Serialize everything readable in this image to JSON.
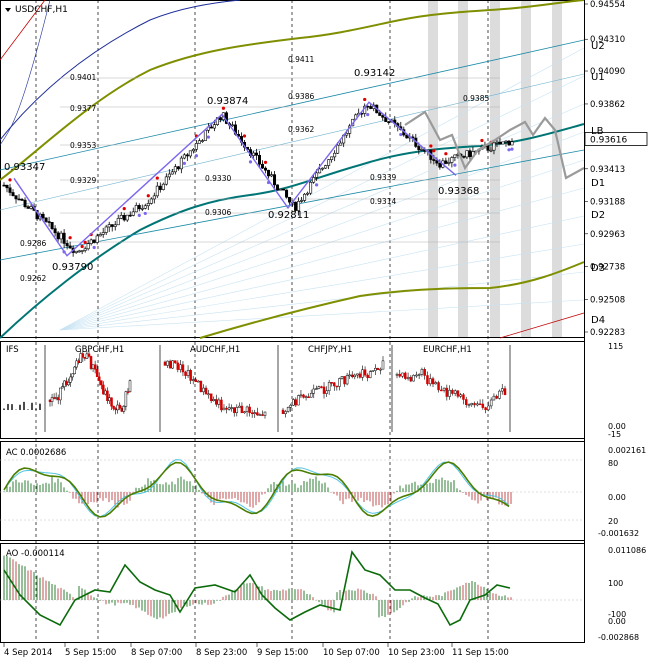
{
  "window": {
    "title": "USDCHF,H1"
  },
  "price_axis": [
    "0.94554",
    "0.94310",
    "0.94090",
    "0.93862",
    "0.93616",
    "0.93413",
    "0.93188",
    "0.92963",
    "0.92738",
    "0.92508",
    "0.92283"
  ],
  "current_price": "0.93616",
  "levels": [
    "U2",
    "U1",
    "LB",
    "D1",
    "D2",
    "D3",
    "D4"
  ],
  "level_values": [
    {
      "text": "0.9401",
      "price": 0.9401
    },
    {
      "text": "0.9411",
      "price": 0.9411
    },
    {
      "text": "0.9377",
      "price": 0.9377
    },
    {
      "text": "0.9386",
      "price": 0.9386
    },
    {
      "text": "0.9385",
      "price": 0.9385
    },
    {
      "text": "0.9353",
      "price": 0.9353
    },
    {
      "text": "0.9362",
      "price": 0.9362
    },
    {
      "text": "0.9329",
      "price": 0.9329
    },
    {
      "text": "0.9330",
      "price": 0.933
    },
    {
      "text": "0.9339",
      "price": 0.9339
    },
    {
      "text": "0.9306",
      "price": 0.9306
    },
    {
      "text": "0.9314",
      "price": 0.9314
    },
    {
      "text": "0.9286",
      "price": 0.9286
    },
    {
      "text": "0.9262",
      "price": 0.9262
    }
  ],
  "pivot_labels": [
    {
      "text": "0.93347",
      "price": 0.93347
    },
    {
      "text": "0.93790",
      "price": 0.9379
    },
    {
      "text": "0.93874",
      "price": 0.93874
    },
    {
      "text": "0.92811",
      "price": 0.92811
    },
    {
      "text": "0.93142",
      "price": 0.93142
    },
    {
      "text": "0.93368",
      "price": 0.93368
    }
  ],
  "time_axis": [
    "4 Sep 2014",
    "5 Sep 15:00",
    "8 Sep 07:00",
    "8 Sep 23:00",
    "9 Sep 15:00",
    "10 Sep 07:00",
    "10 Sep 23:00",
    "11 Sep 15:00"
  ],
  "sub_panels": {
    "ifs": {
      "label": "IFS",
      "symbols": [
        "GBPCHF,H1",
        "AUDCHF,H1",
        "CHFJPY,H1",
        "EURCHF,H1"
      ],
      "axis": [
        "115",
        "0.00",
        "-15"
      ]
    },
    "ac": {
      "label": "AC 0.0002686",
      "axis": [
        "0.002161",
        "80",
        "0.00",
        "20",
        "-0.001632"
      ]
    },
    "ao": {
      "label": "AO -0.000114",
      "axis": [
        "0.011086",
        "100",
        "-100",
        "0.00",
        "-0.002868"
      ]
    }
  },
  "chart_data": {
    "type": "line",
    "title": "USDCHF,H1",
    "x": [
      "4 Sep 2014",
      "5 Sep 15:00",
      "8 Sep 07:00",
      "8 Sep 23:00",
      "9 Sep 15:00",
      "10 Sep 07:00",
      "10 Sep 23:00",
      "11 Sep 15:00"
    ],
    "ylim": [
      0.92283,
      0.94554
    ],
    "series": [
      {
        "name": "USDCHF,H1",
        "points": [
          [
            0,
            0.933
          ],
          [
            1,
            0.9284
          ],
          [
            2,
            0.932
          ],
          [
            3,
            0.9379
          ],
          [
            4,
            0.9314
          ],
          [
            5,
            0.9387
          ],
          [
            6,
            0.9345
          ],
          [
            7,
            0.9361
          ]
        ]
      }
    ],
    "zigzag": [
      0.93347,
      0.92811,
      0.9379,
      0.93142,
      0.93874,
      0.93368
    ],
    "colors": {
      "price": "#000000",
      "bull": "#2e7d32",
      "bear": "#d40000",
      "zigzag": "#7b68ee",
      "channel_outer": "#808000",
      "ma": "#008080",
      "fan": "#2b7fb8"
    }
  }
}
